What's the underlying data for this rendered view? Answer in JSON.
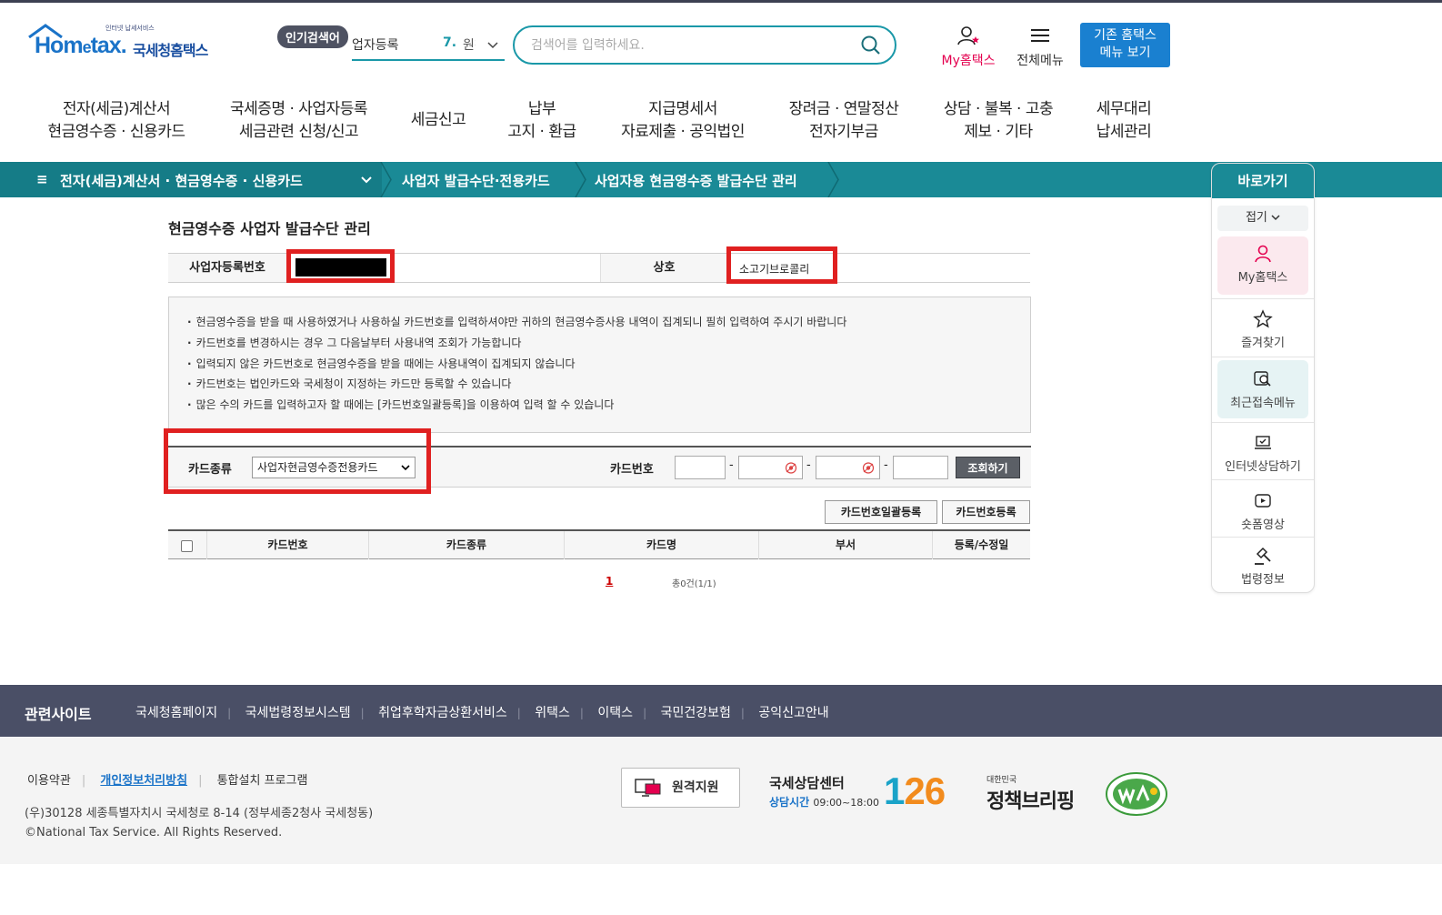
{
  "header": {
    "logo_tag": "인터넷 납세서비스",
    "logo_home": "Hom",
    "logo_e": "e",
    "logo_tax": "tax.",
    "logo_kr": "국세청홈택스",
    "popular_badge": "인기검색어",
    "popular_text": "업자등록",
    "popular_rank": "7.",
    "popular_word": "원천",
    "search_placeholder": "검색어를 입력하세요.",
    "my_hometax": "My홈택스",
    "all_menu": "전체메뉴",
    "legacy_line1": "기존 홈택스",
    "legacy_line2": "메뉴 보기"
  },
  "gnb": [
    {
      "l1": "전자(세금)계산서",
      "l2": "현금영수증 · 신용카드"
    },
    {
      "l1": "국세증명 · 사업자등록",
      "l2": "세금관련 신청/신고"
    },
    {
      "l1": "세금신고",
      "l2": ""
    },
    {
      "l1": "납부",
      "l2": "고지 · 환급"
    },
    {
      "l1": "지급명세서",
      "l2": "자료제출 · 공익법인"
    },
    {
      "l1": "장려금 · 연말정산",
      "l2": "전자기부금"
    },
    {
      "l1": "상담 · 불복 · 고충",
      "l2": "제보 · 기타"
    },
    {
      "l1": "세무대리",
      "l2": "납세관리"
    }
  ],
  "breadcrumb": {
    "menu_icon": "≡",
    "first": "전자(세금)계산서 · 현금영수증 · 신용카드",
    "second": "사업자 발급수단·전용카드",
    "third": "사업자용 현금영수증 발급수단 관리"
  },
  "quick": {
    "title": "바로가기",
    "fold": "접기",
    "items": [
      "My홈택스",
      "즐겨찾기",
      "최근접속메뉴",
      "인터넷상담하기",
      "숏폼영상",
      "법령정보"
    ]
  },
  "page": {
    "title": "현금영수증 사업자 발급수단 관리",
    "biz_no_label": "사업자등록번호",
    "biz_name_label": "상호",
    "biz_name": "소고기브로콜리",
    "notices": [
      "현금영수증을 받을 때 사용하였거나 사용하실 카드번호를 입력하셔야만 귀하의 현금영수증사용 내역이 집계되니 필히 입력하여 주시기 바랍니다",
      "카드번호를 변경하시는 경우 그 다음날부터 사용내역 조회가 가능합니다",
      "입력되지 않은 카드번호로 현금영수증을 받을 때에는 사용내역이 집계되지 않습니다",
      "카드번호는 법인카드와 국세청이 지정하는 카드만 등록할 수 있습니다",
      "많은 수의 카드를 입력하고자 할 때에는 [카드번호일괄등록]을 이용하여 입력 할 수 있습니다"
    ],
    "card_type_label": "카드종류",
    "card_type_value": "사업자현금영수증전용카드",
    "card_no_label": "카드번호",
    "search_btn": "조회하기",
    "bulk_btn": "카드번호일괄등록",
    "reg_btn": "카드번호등록",
    "columns": [
      "카드번호",
      "카드종류",
      "카드명",
      "부서",
      "등록/수정일"
    ],
    "page_no": "1",
    "total": "총0건(1/1)"
  },
  "footer": {
    "related_title": "관련사이트",
    "related_links": [
      "국세청홈페이지",
      "국세법령정보시스템",
      "취업후학자금상환서비스",
      "위택스",
      "이택스",
      "국민건강보험",
      "공익신고안내"
    ],
    "terms": "이용약관",
    "privacy": "개인정보처리방침",
    "install": "통합설치 프로그램",
    "address": "(우)30128 세종특별자치시 국세청로 8-14 (정부세종2청사 국세청동)",
    "copyright": "©National Tax Service. All Rights Reserved.",
    "remote": "원격지원",
    "call_title": "국세상담센터",
    "call_hours_label": "상담시간",
    "call_hours": "09:00~18:00",
    "call_no_1": "1",
    "call_no_rest": "26",
    "brief_small": "대한민국",
    "brief_big": "정책브리핑"
  },
  "colors": {
    "teal": "#1a8a96",
    "red_highlight": "#e02020",
    "brand_blue": "#1a73c8",
    "my_pink": "#e4004f"
  }
}
